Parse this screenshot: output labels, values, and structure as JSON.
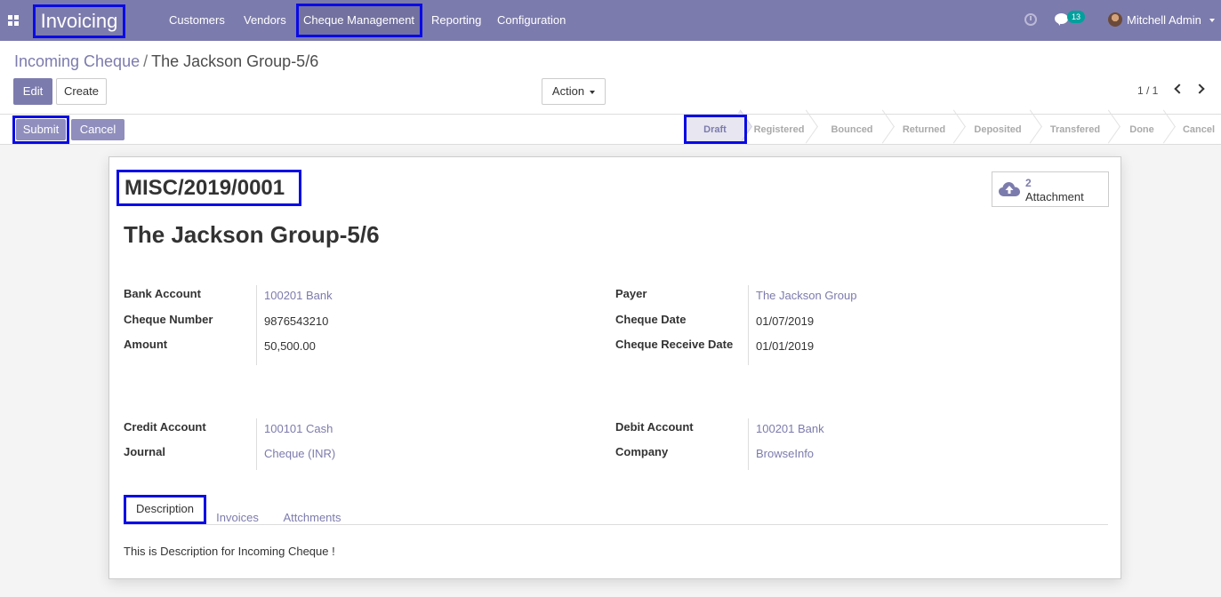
{
  "topbar": {
    "app_name": "Invoicing",
    "menu": [
      "Customers",
      "Vendors",
      "Cheque Management",
      "Reporting",
      "Configuration"
    ],
    "message_count": "13",
    "user_name": "Mitchell Admin"
  },
  "breadcrumb": {
    "parent": "Incoming Cheque",
    "separator": "/",
    "current": "The Jackson Group-5/6"
  },
  "buttons": {
    "edit": "Edit",
    "create": "Create",
    "action": "Action",
    "submit": "Submit",
    "cancel": "Cancel"
  },
  "pager": "1 / 1",
  "stages": [
    "Draft",
    "Registered",
    "Bounced",
    "Returned",
    "Deposited",
    "Transfered",
    "Done",
    "Cancel"
  ],
  "active_stage": "Draft",
  "attachment": {
    "count": "2",
    "label": "Attachment"
  },
  "record": {
    "reference": "MISC/2019/0001",
    "title": "The Jackson Group-5/6"
  },
  "fields_left": [
    {
      "label": "Bank Account",
      "value": "100201 Bank",
      "link": true
    },
    {
      "label": "Cheque Number",
      "value": "9876543210",
      "link": false
    },
    {
      "label": "Amount",
      "value": "50,500.00",
      "link": false
    }
  ],
  "fields_right": [
    {
      "label": "Payer",
      "value": "The Jackson Group",
      "link": true
    },
    {
      "label": "Cheque Date",
      "value": "01/07/2019",
      "link": false
    },
    {
      "label": "Cheque Receive Date",
      "value": "01/01/2019",
      "link": false
    }
  ],
  "fields_left2": [
    {
      "label": "Credit Account",
      "value": "100101 Cash",
      "link": true
    },
    {
      "label": "Journal",
      "value": "Cheque (INR)",
      "link": true
    }
  ],
  "fields_right2": [
    {
      "label": "Debit Account",
      "value": "100201 Bank",
      "link": true
    },
    {
      "label": "Company",
      "value": "BrowseInfo",
      "link": true
    }
  ],
  "tabs": [
    "Description",
    "Invoices",
    "Attchments"
  ],
  "description": "This is Description for Incoming Cheque !",
  "colors": {
    "brand": "#7c7bad",
    "highlight": "#0a0ae6",
    "badge": "#00a09d"
  }
}
